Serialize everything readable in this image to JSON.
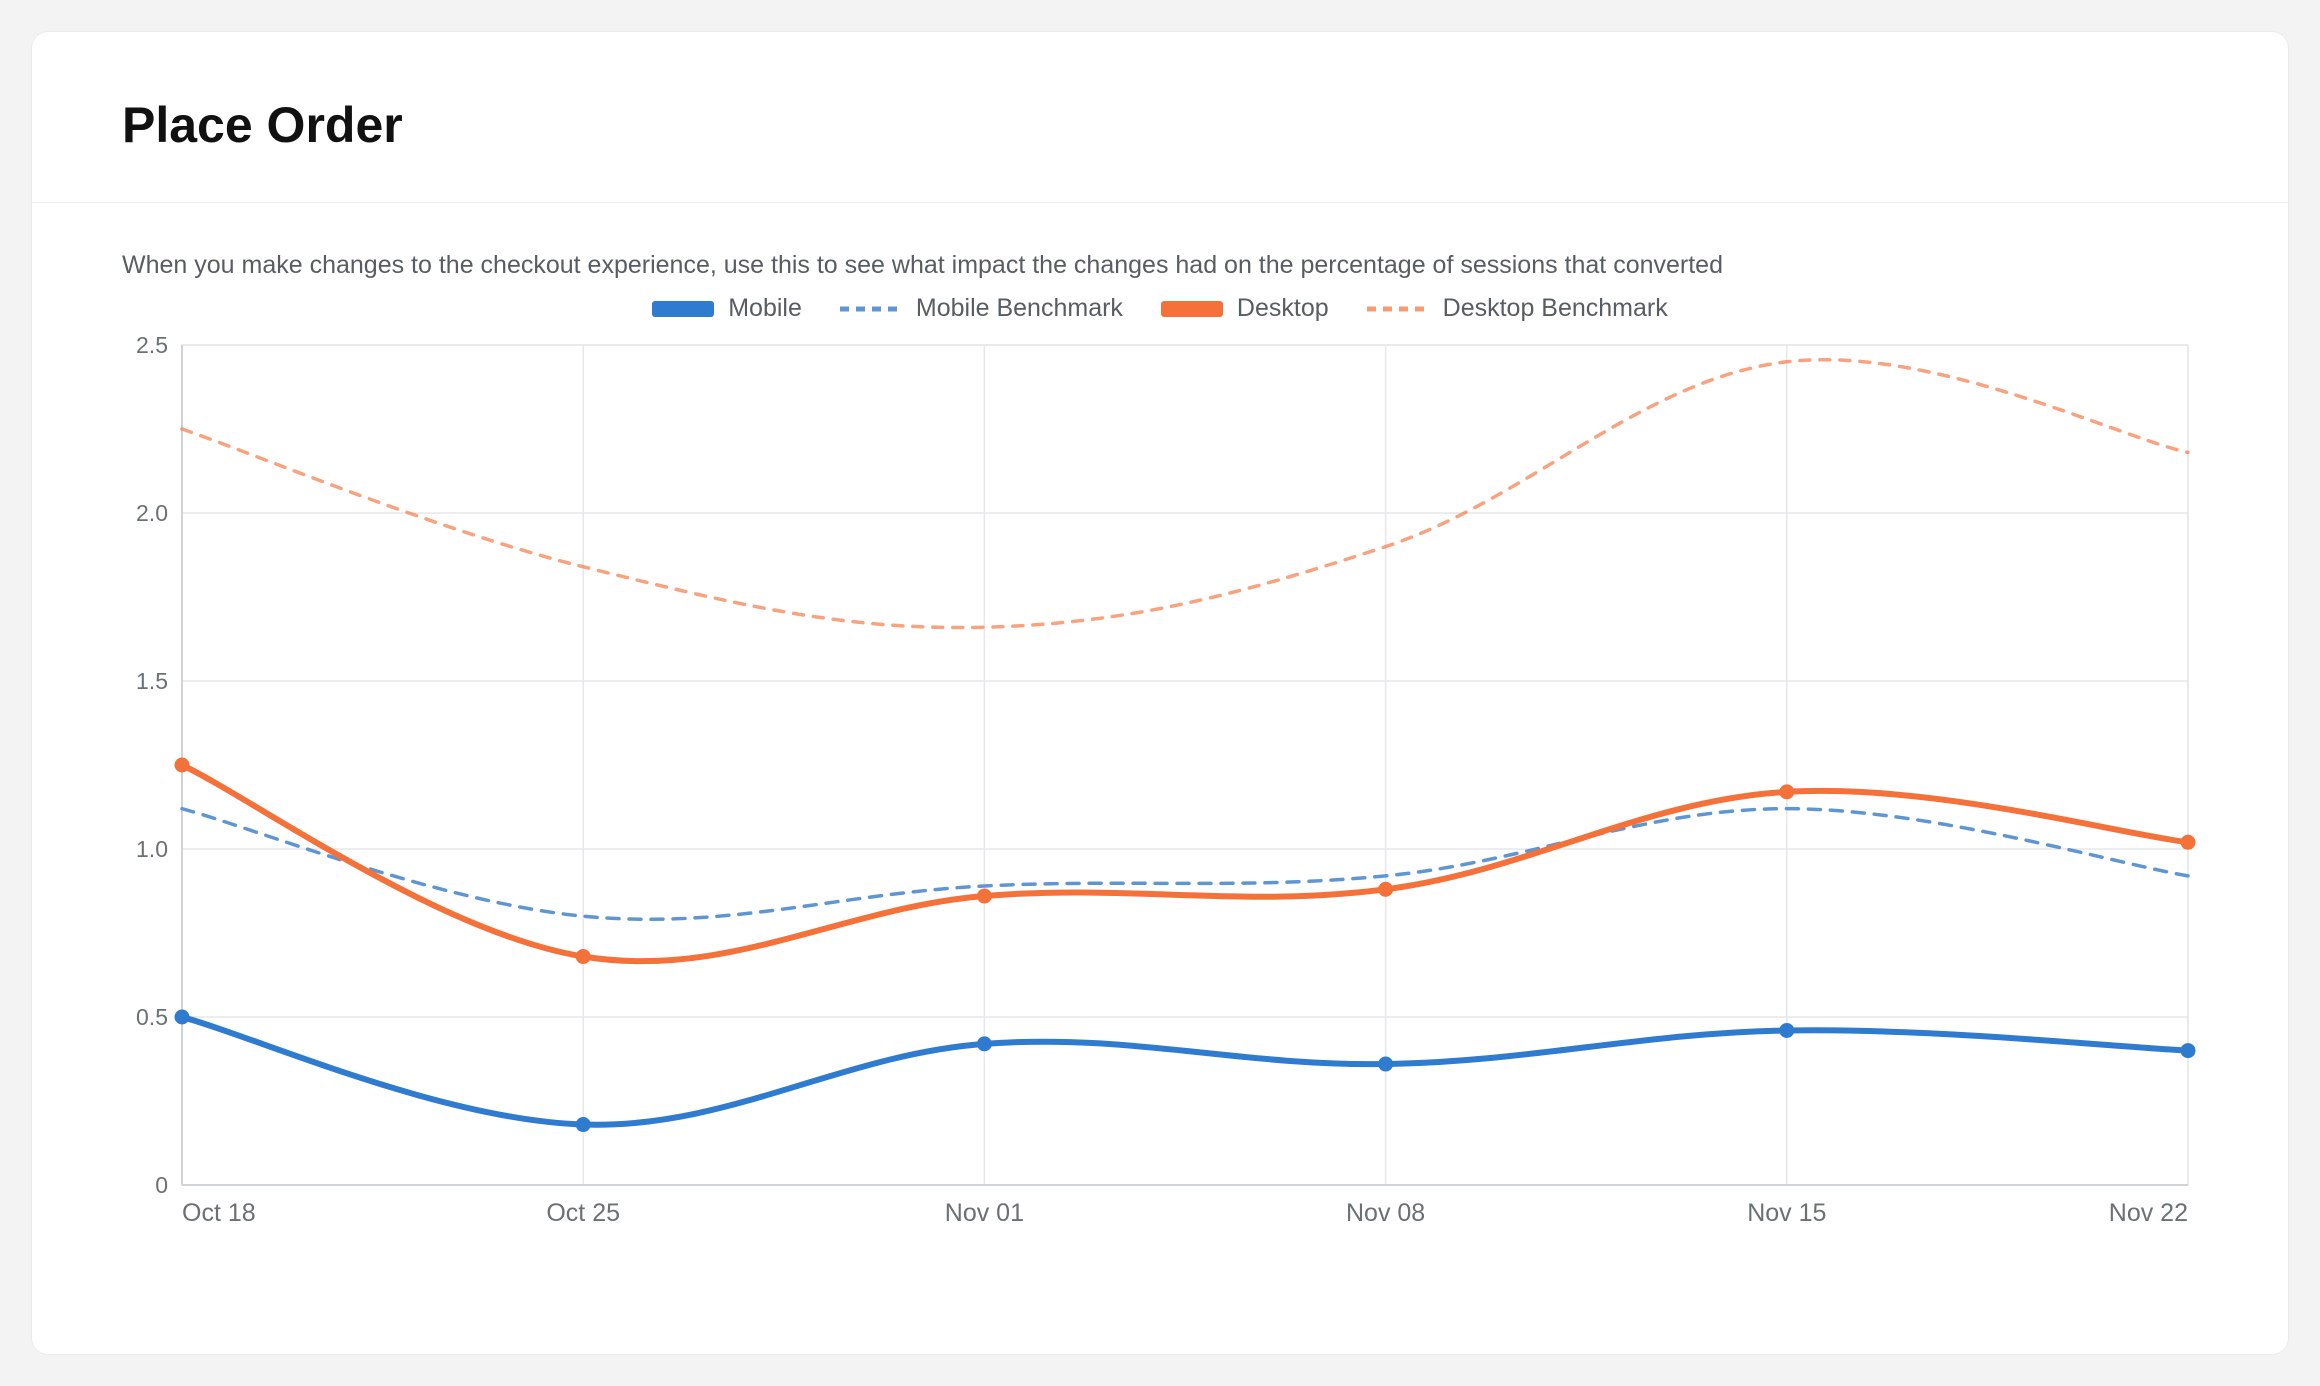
{
  "card": {
    "title": "Place Order",
    "subtitle": "When you make changes to the checkout experience, use this to see what impact the changes had on the percentage of sessions that converted"
  },
  "legend": {
    "mobile": "Mobile",
    "mobile_benchmark": "Mobile Benchmark",
    "desktop": "Desktop",
    "desktop_benchmark": "Desktop Benchmark"
  },
  "colors": {
    "mobile": "#2f7bcf",
    "mobile_benchmark": "#5f96d1",
    "desktop": "#f4713a",
    "desktop_benchmark": "#f4713a"
  },
  "y_ticks": [
    "0",
    "0.5",
    "1.0",
    "1.5",
    "2.0",
    "2.5"
  ],
  "x_ticks": [
    "Oct 18",
    "Oct 25",
    "Nov 01",
    "Nov 08",
    "Nov 15",
    "Nov 22"
  ],
  "chart_data": {
    "type": "line",
    "title": "Place Order",
    "xlabel": "",
    "ylabel": "",
    "ylim": [
      0,
      2.5
    ],
    "categories": [
      "Oct 18",
      "Oct 25",
      "Nov 01",
      "Nov 08",
      "Nov 15",
      "Nov 22"
    ],
    "series": [
      {
        "name": "Mobile",
        "style": "solid",
        "color": "#2f7bcf",
        "values": [
          0.5,
          0.18,
          0.42,
          0.36,
          0.46,
          0.4
        ]
      },
      {
        "name": "Mobile Benchmark",
        "style": "dashed",
        "color": "#5f96d1",
        "values": [
          1.12,
          0.8,
          0.89,
          0.92,
          1.12,
          0.92
        ]
      },
      {
        "name": "Desktop",
        "style": "solid",
        "color": "#f4713a",
        "values": [
          1.25,
          0.68,
          0.86,
          0.88,
          1.17,
          1.02
        ]
      },
      {
        "name": "Desktop Benchmark",
        "style": "dashed",
        "color": "#f4713a",
        "values": [
          2.25,
          1.84,
          1.66,
          1.9,
          2.45,
          2.18
        ]
      }
    ]
  }
}
